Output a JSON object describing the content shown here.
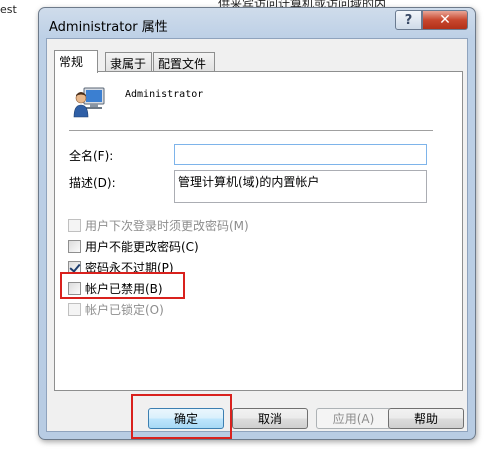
{
  "background": {
    "left_text": "est",
    "top_text": "供来宾访问计算机或访问域的内"
  },
  "window": {
    "title": "Administrator 属性",
    "help_button": "?",
    "close_button": "✕"
  },
  "tabs": [
    {
      "label": "常规",
      "active": true
    },
    {
      "label": "隶属于",
      "active": false
    },
    {
      "label": "配置文件",
      "active": false
    }
  ],
  "user": {
    "icon": "user-computer-icon",
    "name": "Administrator"
  },
  "form": {
    "fullname_label": "全名(F):",
    "fullname_value": "",
    "description_label": "描述(D):",
    "description_value": "管理计算机(域)的内置帐户"
  },
  "checkboxes": [
    {
      "label": "用户下次登录时须更改密码(M)",
      "checked": false,
      "disabled": true
    },
    {
      "label": "用户不能更改密码(C)",
      "checked": false,
      "disabled": false
    },
    {
      "label": "密码永不过期(P)",
      "checked": true,
      "disabled": false
    },
    {
      "label": "帐户已禁用(B)",
      "checked": false,
      "disabled": false
    },
    {
      "label": "帐户已锁定(O)",
      "checked": false,
      "disabled": true
    }
  ],
  "buttons": {
    "ok": "确定",
    "cancel": "取消",
    "apply": "应用(A)",
    "help": "帮助"
  },
  "colors": {
    "highlight": "#d9211d",
    "close_button": "#c8472e"
  }
}
